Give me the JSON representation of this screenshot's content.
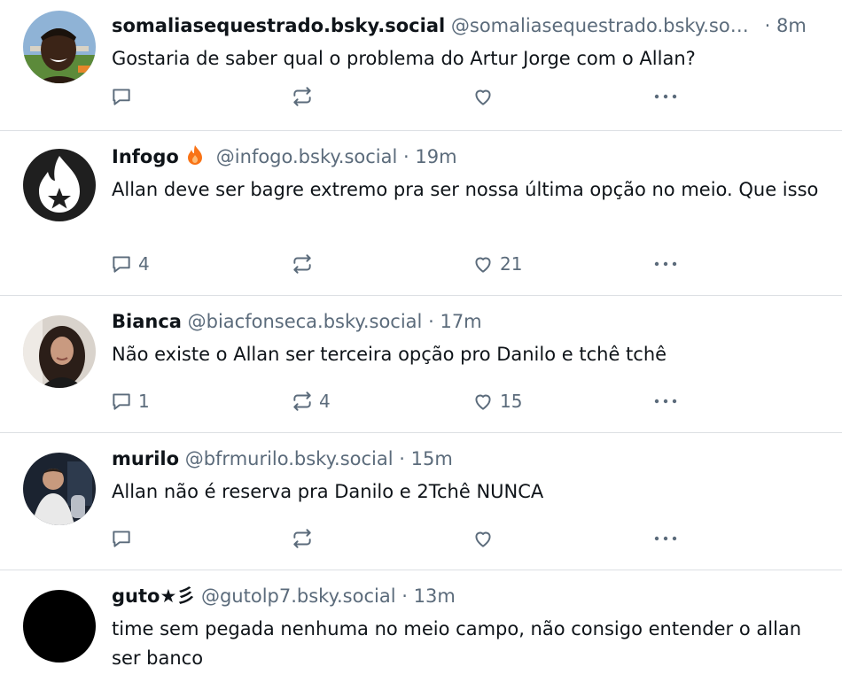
{
  "colors": {
    "text": "#0f1419",
    "muted": "#5b6b7b",
    "divider": "#dcdfe3",
    "flame": "#f97316"
  },
  "posts": [
    {
      "name": "somaliasequestrado.bsky.social",
      "handle": "@somaliasequestrado.bsky.social",
      "dot": "·",
      "time": "8m",
      "text": "Gostaria de saber qual o problema do Artur Jorge com o Allan?",
      "replies": "",
      "reposts": "",
      "likes": ""
    },
    {
      "name": "Infogo",
      "name_icon": "flame-icon",
      "handle": "@infogo.bsky.social",
      "dot": "·",
      "time": "19m",
      "text": "Allan deve ser bagre extremo pra ser nossa última opção no meio. Que isso",
      "replies": "4",
      "reposts": "",
      "likes": "21"
    },
    {
      "name": "Bianca",
      "handle": "@biacfonseca.bsky.social",
      "dot": "·",
      "time": "17m",
      "text": "Não existe o Allan ser terceira opção pro Danilo e tchê tchê",
      "replies": "1",
      "reposts": "4",
      "likes": "15"
    },
    {
      "name": "murilo",
      "handle": "@bfrmurilo.bsky.social",
      "dot": "·",
      "time": "15m",
      "text": "Allan não é reserva pra Danilo e 2Tchê NUNCA",
      "replies": "",
      "reposts": "",
      "likes": ""
    },
    {
      "name": "guto★彡",
      "handle": "@gutolp7.bsky.social",
      "dot": "·",
      "time": "13m",
      "text": "time sem pegada nenhuma no meio campo, não consigo entender o allan ser banco",
      "replies": "",
      "reposts": "",
      "likes": ""
    }
  ]
}
